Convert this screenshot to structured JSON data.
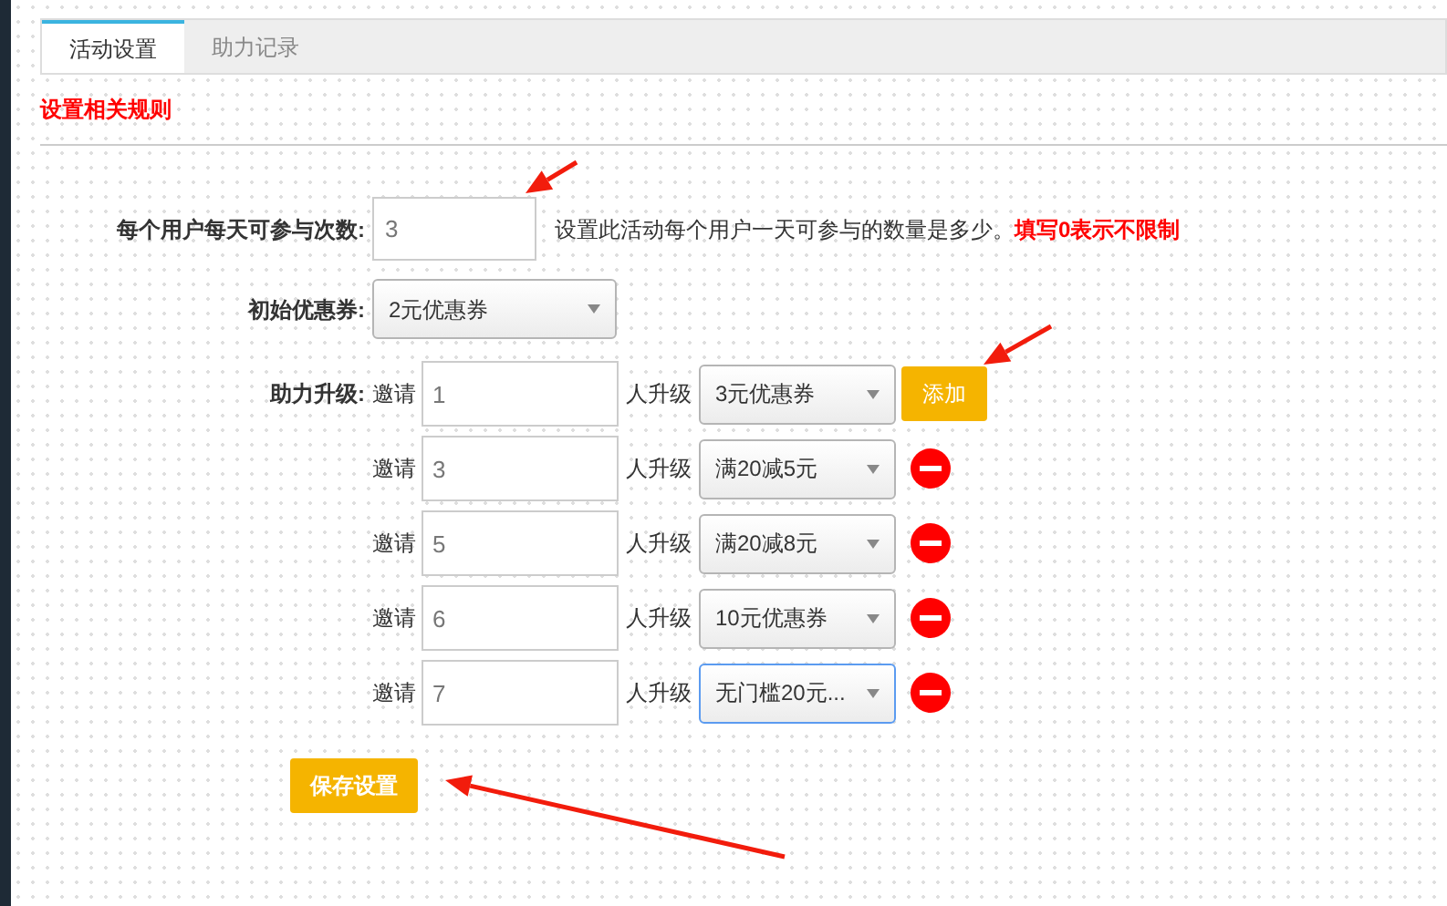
{
  "tabs": [
    {
      "label": "活动设置",
      "selected": true
    },
    {
      "label": "助力记录",
      "selected": false
    }
  ],
  "section_title": "设置相关规则",
  "daily_limit": {
    "label": "每个用户每天可参与次数:",
    "value": "3",
    "hint": "设置此活动每个用户一天可参与的数量是多少。",
    "hint_emphasis": "填写0表示不限制"
  },
  "initial_coupon": {
    "label": "初始优惠券:",
    "value": "2元优惠券"
  },
  "upgrades": {
    "label": "助力升级:",
    "add_button": "添加",
    "rows": [
      {
        "prefix": "邀请",
        "count": "1",
        "suffix": "人升级",
        "coupon": "3元优惠券",
        "focused": false
      },
      {
        "prefix": "邀请",
        "count": "3",
        "suffix": "人升级",
        "coupon": "满20减5元",
        "focused": false
      },
      {
        "prefix": "邀请",
        "count": "5",
        "suffix": "人升级",
        "coupon": "满20减8元",
        "focused": false
      },
      {
        "prefix": "邀请",
        "count": "6",
        "suffix": "人升级",
        "coupon": "10元优惠券",
        "focused": false
      },
      {
        "prefix": "邀请",
        "count": "7",
        "suffix": "人升级",
        "coupon": "无门槛20元...",
        "focused": true
      }
    ]
  },
  "save_button": "保存设置"
}
